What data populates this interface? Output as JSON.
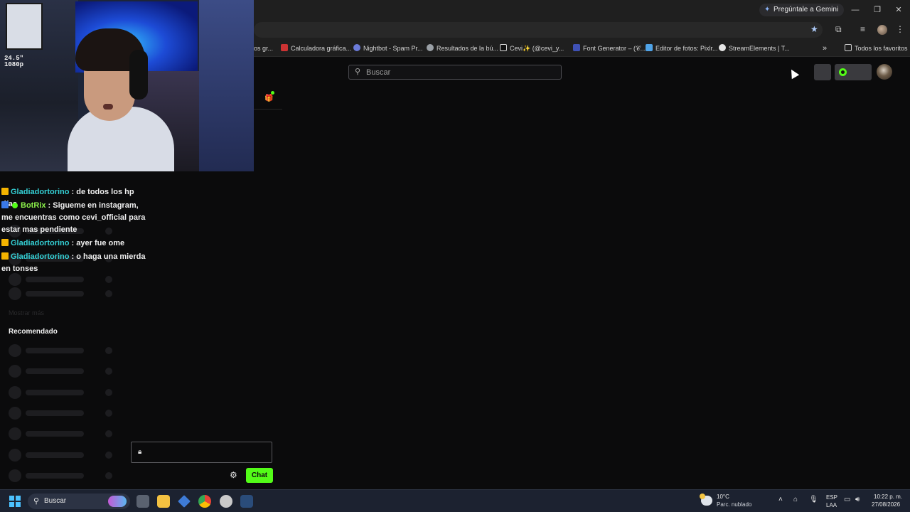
{
  "browser": {
    "gemini_label": "Pregúntale a Gemini",
    "window_controls": [
      "—",
      "❐",
      "✕"
    ],
    "bookmarks": [
      {
        "label": "os gr...",
        "icon": "page-icon"
      },
      {
        "label": "Calculadora gráfica...",
        "icon": "desmos-icon"
      },
      {
        "label": "Nightbot - Spam Pr...",
        "icon": "nightbot-icon"
      },
      {
        "label": "Resultados de la bú...",
        "icon": "globe-icon"
      },
      {
        "label": "Cevi✨ (@cevi_y...",
        "icon": "tiktok-icon",
        "prefix": "✨"
      },
      {
        "label": "Font Generator – (𝒞...",
        "icon": "font-icon"
      },
      {
        "label": "Editor de fotos: Pixlr...",
        "icon": "pixlr-icon"
      },
      {
        "label": "StreamElements | T...",
        "icon": "streamelements-icon"
      }
    ],
    "bookmarks_overflow": "»",
    "all_favorites": "Todos los favoritos"
  },
  "page": {
    "search_placeholder": "Buscar",
    "accent": "#53fc18"
  },
  "chat": {
    "messages": [
      {
        "badge": "crown",
        "user": "Gladiadortorino",
        "text": " : de todos los hp días"
      },
      {
        "badge": "bot",
        "verified": true,
        "user": "BotRix",
        "text": " : Sigueme en instagram, me encuentras como cevi_official para estar mas pendiente"
      },
      {
        "badge": "crown",
        "user": "Gladiadortorino",
        "text": " : ayer fue ome"
      },
      {
        "badge": "crown",
        "user": "Gladiadortorino",
        "text": " : o haga una mierda en tonses"
      }
    ],
    "input_placeholder": "",
    "send_label": "Chat"
  },
  "sidebar": {
    "show_more": "Mostrar más",
    "recommended_title": "Recomendado"
  },
  "webcam": {
    "monitor_label_1": "24.5\"",
    "monitor_label_2": "1080p"
  },
  "taskbar": {
    "search_label": "Buscar",
    "weather_temp": "10°C",
    "weather_desc": "Parc. nublado",
    "lang_1": "ESP",
    "lang_2": "LAA",
    "time": "10:22 p. m.",
    "date": "27/08/2026"
  }
}
